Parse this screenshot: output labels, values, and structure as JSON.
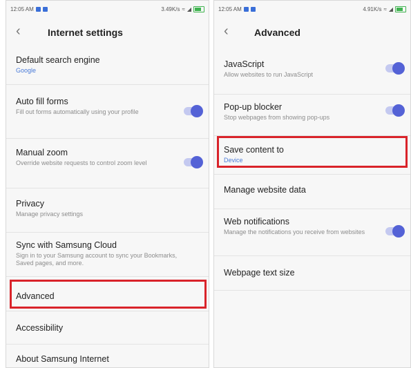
{
  "left": {
    "status": {
      "time": "12:05 AM",
      "speed": "3.49K/s"
    },
    "title": "Internet settings",
    "items": [
      {
        "title": "Default search engine",
        "desc": "Google"
      },
      {
        "title": "Auto fill forms",
        "desc": "Fill out forms automatically using your profile",
        "toggle": true
      },
      {
        "title": "Manual zoom",
        "desc": "Override website requests to control zoom level",
        "toggle": true
      },
      {
        "title": "Privacy",
        "desc": "Manage privacy settings"
      },
      {
        "title": "Sync with Samsung Cloud",
        "desc": "Sign in to your Samsung account to sync your Bookmarks, Saved pages, and more."
      },
      {
        "title": "Advanced",
        "desc": ""
      },
      {
        "title": "Accessibility",
        "desc": ""
      },
      {
        "title": "About Samsung Internet",
        "desc": ""
      }
    ]
  },
  "right": {
    "status": {
      "time": "12:05 AM",
      "speed": "4.91K/s"
    },
    "title": "Advanced",
    "items": [
      {
        "title": "JavaScript",
        "desc": "Allow websites to run JavaScript",
        "toggle": true
      },
      {
        "title": "Pop-up blocker",
        "desc": "Stop webpages from showing pop-ups",
        "toggle": true
      },
      {
        "title": "Save content to",
        "desc": "Device"
      },
      {
        "title": "Manage website data",
        "desc": ""
      },
      {
        "title": "Web notifications",
        "desc": "Manage the notifications you receive from websites",
        "toggle": true
      },
      {
        "title": "Webpage text size",
        "desc": ""
      }
    ]
  },
  "colors": {
    "accent": "#5462d6",
    "highlight": "#d9232a",
    "link": "#4a7bd8"
  }
}
